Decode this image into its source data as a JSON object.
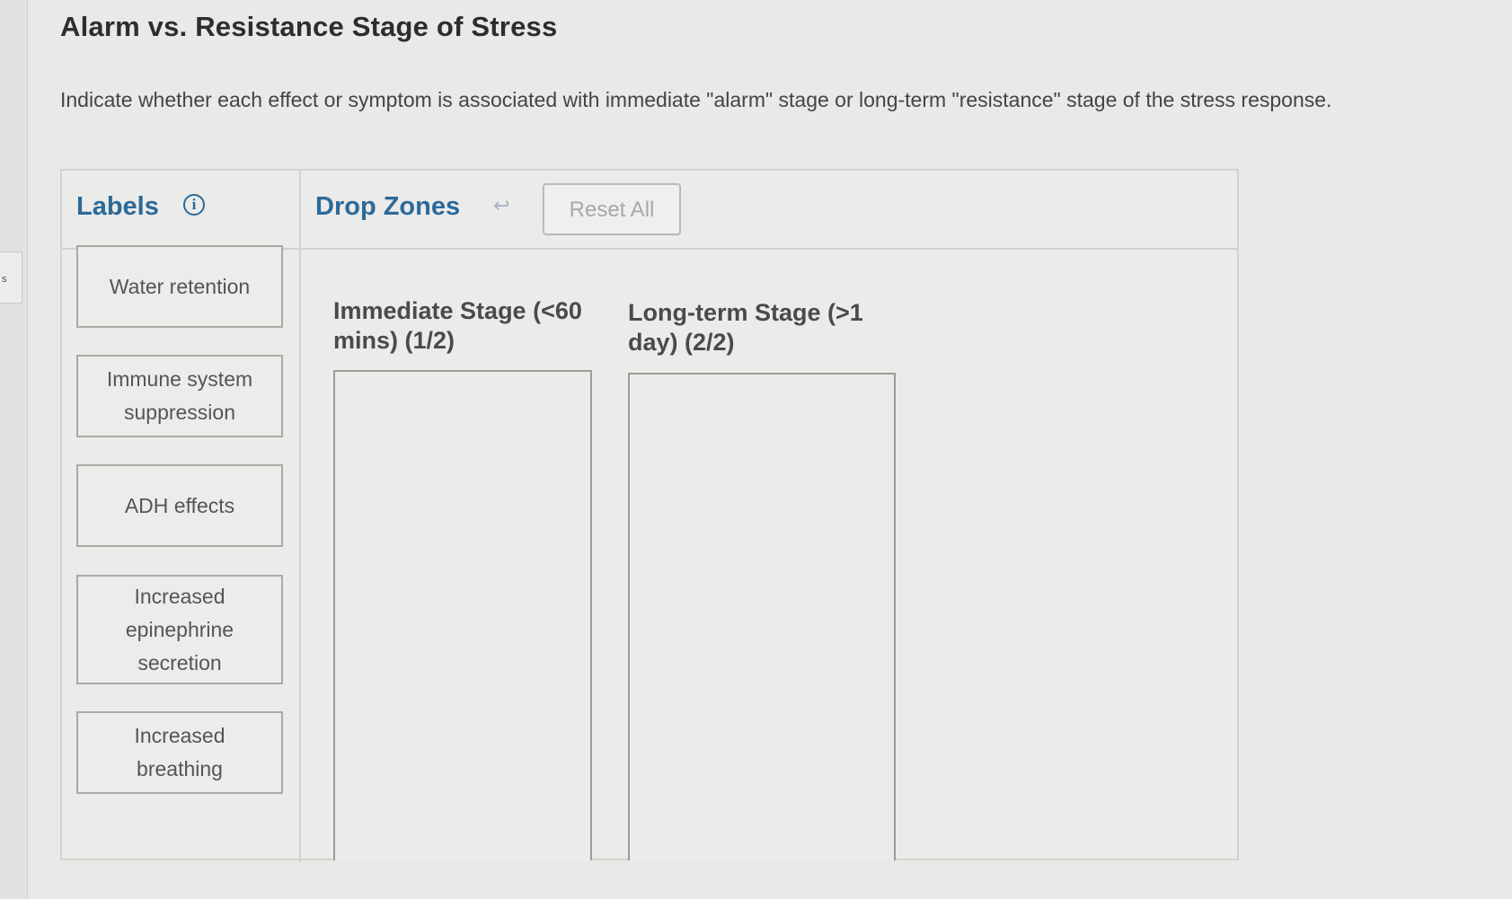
{
  "page": {
    "title": "Alarm vs. Resistance Stage of Stress",
    "instructions": "Indicate whether each effect or symptom is associated with immediate \"alarm\" stage or long-term \"resistance\" stage of the stress response.",
    "left_tab_glyph": "s"
  },
  "widget": {
    "labels_heading": "Labels",
    "info_icon_glyph": "i",
    "drop_zones_heading": "Drop Zones",
    "undo_icon_glyph": "↩",
    "reset_label": "Reset All",
    "labels": [
      "Water retention",
      "Immune system suppression",
      "ADH effects",
      "Increased epinephrine secretion",
      "Increased breathing"
    ],
    "zones": [
      "Immediate Stage (<60 mins) (1/2)",
      "Long-term Stage (>1 day) (2/2)"
    ]
  },
  "colors": {
    "accent": "#2b6a99",
    "background": "#e9e9e7"
  }
}
